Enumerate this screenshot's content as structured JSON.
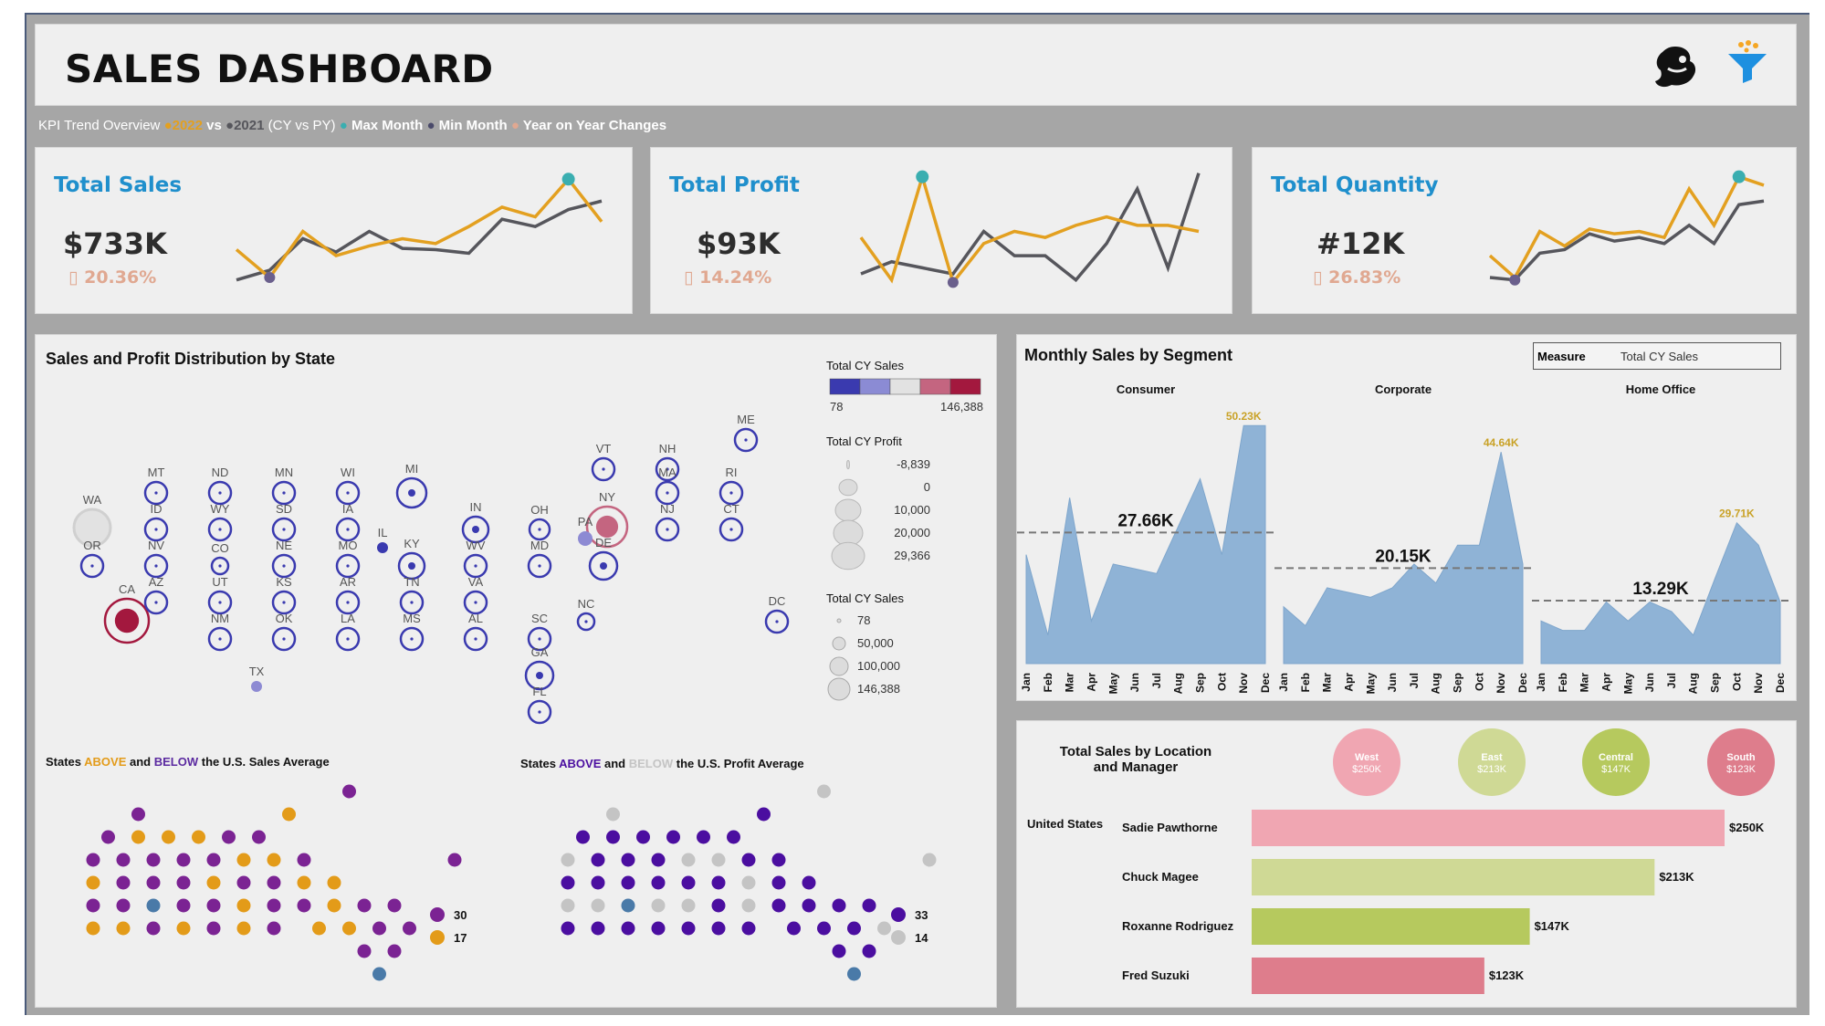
{
  "header": {
    "title": "SALES DASHBOARD"
  },
  "legend": {
    "prefix": "KPI Trend Overview ",
    "dot1": "●",
    "cy": "2022",
    "vs": " vs ",
    "dot2": "●",
    "py": "2021",
    "cypy": " (CY vs PY) ",
    "dot3": "●",
    "max": " Max Month ",
    "dot4": "●",
    "min": " Min Month ",
    "dot5": "●",
    "yoy": " Year on Year Changes"
  },
  "colors": {
    "cy": "#e3a020",
    "py": "#56565c",
    "max": "#3aaeb0",
    "min": "#6a5f8c",
    "kpi_title": "#1f8fcc",
    "area": "#8fb3d6",
    "purple": "#7b2393",
    "orange": "#e39b19",
    "indigo": "#4b0ea0",
    "grey": "#c4c4c4",
    "outlier": "#4a7aa8",
    "west": "#f0a6b2",
    "east": "#cfd995",
    "central": "#b6c95e",
    "south": "#de7d8c"
  },
  "icons": {
    "logo": "tableau-bird-icon",
    "filter": "funnel-filter-icon"
  },
  "kpis": [
    {
      "title": "Total Sales",
      "value": "$733K",
      "delta_icon": "▯",
      "delta": "20.36%"
    },
    {
      "title": "Total Profit",
      "value": "$93K",
      "delta_icon": "▯",
      "delta": "14.24%"
    },
    {
      "title": "Total Quantity",
      "value": "#12K",
      "delta_icon": "▯",
      "delta": "26.83%"
    }
  ],
  "map": {
    "title": "Sales and Profit Distribution by State",
    "legend_sales_title": "Total CY Sales",
    "legend_sales_min": "78",
    "legend_sales_max": "146,388",
    "legend_profit_title": "Total CY Profit",
    "legend_profit_values": [
      "-8,839",
      "0",
      "10,000",
      "20,000",
      "29,366"
    ],
    "legend_size_title": "Total CY Sales",
    "legend_size_values": [
      "78",
      "50,000",
      "100,000",
      "146,388"
    ],
    "states": [
      "WA",
      "MT",
      "ND",
      "MN",
      "WI",
      "MI",
      "NY",
      "VT",
      "NH",
      "ME",
      "MA",
      "RI",
      "CT",
      "NJ",
      "PA",
      "OH",
      "IN",
      "IL",
      "ID",
      "WY",
      "SD",
      "IA",
      "OR",
      "NV",
      "CO",
      "NE",
      "MO",
      "KY",
      "WV",
      "MD",
      "DE",
      "CA",
      "AZ",
      "UT",
      "KS",
      "AR",
      "TN",
      "VA",
      "NC",
      "DC",
      "NM",
      "OK",
      "LA",
      "MS",
      "AL",
      "SC",
      "GA",
      "TX",
      "FL"
    ]
  },
  "segment": {
    "title": "Monthly Sales by Segment",
    "measure_label": "Measure",
    "measure_value": "Total CY Sales",
    "months": [
      "Jan",
      "Feb",
      "Mar",
      "Apr",
      "May",
      "Jun",
      "Jul",
      "Aug",
      "Sep",
      "Oct",
      "Nov",
      "Dec"
    ],
    "panels": [
      {
        "name": "Consumer",
        "avg_label": "27.66K",
        "max_label": "50.23K"
      },
      {
        "name": "Corporate",
        "avg_label": "20.15K",
        "max_label": "44.64K"
      },
      {
        "name": "Home Office",
        "avg_label": "13.29K",
        "max_label": "29.71K"
      }
    ]
  },
  "avg_sales": {
    "title_pre": "States ",
    "title_above": "ABOVE",
    "title_mid": " and ",
    "title_below": "BELOW",
    "title_post": " the U.S. Sales Average",
    "count_above": "30",
    "count_below": "17"
  },
  "avg_profit": {
    "title_pre": "States ",
    "title_above": "ABOVE",
    "title_mid": " and ",
    "title_below": "BELOW",
    "title_post": " the U.S. Profit Average",
    "count_above": "33",
    "count_below": "14"
  },
  "location": {
    "title_line1": "Total Sales by Location",
    "title_line2": "and Manager",
    "country": "United States",
    "regions": [
      {
        "name": "West",
        "value": "$250K"
      },
      {
        "name": "East",
        "value": "$213K"
      },
      {
        "name": "Central",
        "value": "$147K"
      },
      {
        "name": "South",
        "value": "$123K"
      }
    ],
    "managers": [
      {
        "name": "Sadie Pawthorne",
        "label": "$250K"
      },
      {
        "name": "Chuck Magee",
        "label": "$213K"
      },
      {
        "name": "Roxanne Rodriguez",
        "label": "$147K"
      },
      {
        "name": "Fred Suzuki",
        "label": "$123K"
      }
    ]
  },
  "chart_data": [
    {
      "type": "line",
      "title": "Total Sales",
      "categories": [
        "Jan",
        "Feb",
        "Mar",
        "Apr",
        "May",
        "Jun",
        "Jul",
        "Aug",
        "Sep",
        "Oct",
        "Nov",
        "Dec"
      ],
      "series": [
        {
          "name": "2022",
          "values": [
            0.35,
            0.12,
            0.5,
            0.3,
            0.38,
            0.44,
            0.4,
            0.54,
            0.7,
            0.62,
            0.93,
            0.58
          ]
        },
        {
          "name": "2021",
          "values": [
            0.1,
            0.18,
            0.44,
            0.33,
            0.5,
            0.36,
            0.35,
            0.32,
            0.6,
            0.54,
            0.68,
            0.75
          ]
        }
      ],
      "max_month": "Nov",
      "min_month": "Feb"
    },
    {
      "type": "line",
      "title": "Total Profit",
      "categories": [
        "Jan",
        "Feb",
        "Mar",
        "Apr",
        "May",
        "Jun",
        "Jul",
        "Aug",
        "Sep",
        "Oct",
        "Nov",
        "Dec"
      ],
      "series": [
        {
          "name": "2022",
          "values": [
            0.45,
            0.1,
            0.95,
            0.08,
            0.4,
            0.5,
            0.45,
            0.55,
            0.62,
            0.55,
            0.55,
            0.5
          ]
        },
        {
          "name": "2021",
          "values": [
            0.15,
            0.25,
            0.2,
            0.15,
            0.5,
            0.3,
            0.3,
            0.1,
            0.4,
            0.85,
            0.2,
            0.98
          ]
        }
      ],
      "max_month": "Mar",
      "min_month": "Apr"
    },
    {
      "type": "line",
      "title": "Total Quantity",
      "categories": [
        "Jan",
        "Feb",
        "Mar",
        "Apr",
        "May",
        "Jun",
        "Jul",
        "Aug",
        "Sep",
        "Oct",
        "Nov",
        "Dec"
      ],
      "series": [
        {
          "name": "2022",
          "values": [
            0.3,
            0.12,
            0.5,
            0.38,
            0.52,
            0.48,
            0.5,
            0.45,
            0.85,
            0.55,
            0.95,
            0.88
          ]
        },
        {
          "name": "2021",
          "values": [
            0.12,
            0.1,
            0.32,
            0.35,
            0.48,
            0.42,
            0.45,
            0.4,
            0.55,
            0.4,
            0.72,
            0.75
          ]
        }
      ],
      "max_month": "Nov",
      "min_month": "Feb"
    },
    {
      "type": "area",
      "title": "Monthly Sales by Segment",
      "categories": [
        "Jan",
        "Feb",
        "Mar",
        "Apr",
        "May",
        "Jun",
        "Jul",
        "Aug",
        "Sep",
        "Oct",
        "Nov",
        "Dec"
      ],
      "series": [
        {
          "name": "Consumer",
          "values": [
            23,
            6,
            35,
            9,
            21,
            20,
            19,
            29,
            39,
            23,
            50.23,
            50.23
          ],
          "average": 27.66
        },
        {
          "name": "Corporate",
          "values": [
            12,
            8,
            16,
            15,
            14,
            16,
            21,
            17,
            25,
            25,
            44.64,
            21
          ],
          "average": 20.15
        },
        {
          "name": "Home Office",
          "values": [
            9,
            7,
            7,
            13,
            9,
            13,
            11,
            6,
            18,
            29.71,
            25,
            13
          ],
          "average": 13.29
        }
      ],
      "ylim": [
        0,
        52
      ]
    },
    {
      "type": "bar",
      "title": "Total Sales by Location and Manager",
      "categories": [
        "Sadie Pawthorne",
        "Chuck Magee",
        "Roxanne Rodriguez",
        "Fred Suzuki"
      ],
      "values": [
        250,
        213,
        147,
        123
      ],
      "units": "$K"
    }
  ]
}
